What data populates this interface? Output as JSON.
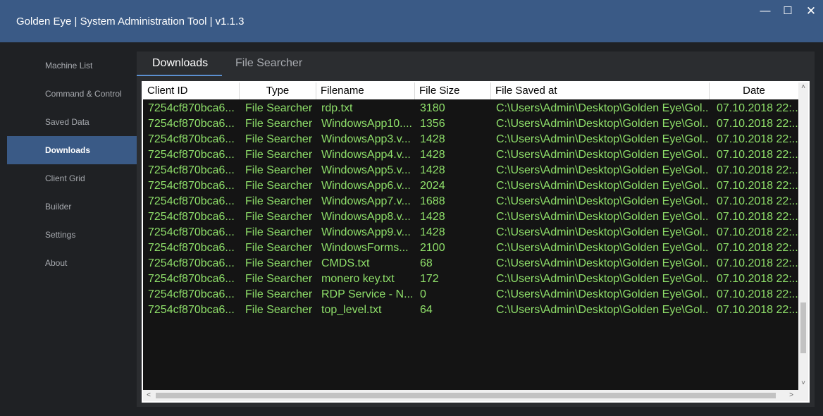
{
  "window": {
    "title": "Golden Eye | System Administration Tool | v1.1.3",
    "minimize_glyph": "—",
    "maximize_glyph": "☐",
    "close_glyph": "✕"
  },
  "sidebar": {
    "items": [
      {
        "label": "Machine List"
      },
      {
        "label": "Command & Control"
      },
      {
        "label": "Saved Data"
      },
      {
        "label": "Downloads",
        "active": true
      },
      {
        "label": "Client Grid"
      },
      {
        "label": "Builder"
      },
      {
        "label": "Settings"
      },
      {
        "label": "About"
      }
    ]
  },
  "tabs": [
    {
      "label": "Downloads",
      "active": true
    },
    {
      "label": "File Searcher"
    }
  ],
  "table": {
    "columns": [
      "Client ID",
      "Type",
      "Filename",
      "File Size",
      "File Saved at",
      "Date"
    ],
    "rows": [
      [
        "7254cf870bca6...",
        "File Searcher",
        "rdp.txt",
        "3180",
        "C:\\Users\\Admin\\Desktop\\Golden Eye\\Gol...",
        "07.10.2018 22:..."
      ],
      [
        "7254cf870bca6...",
        "File Searcher",
        "WindowsApp10....",
        "1356",
        "C:\\Users\\Admin\\Desktop\\Golden Eye\\Gol...",
        "07.10.2018 22:..."
      ],
      [
        "7254cf870bca6...",
        "File Searcher",
        "WindowsApp3.v...",
        "1428",
        "C:\\Users\\Admin\\Desktop\\Golden Eye\\Gol...",
        "07.10.2018 22:..."
      ],
      [
        "7254cf870bca6...",
        "File Searcher",
        "WindowsApp4.v...",
        "1428",
        "C:\\Users\\Admin\\Desktop\\Golden Eye\\Gol...",
        "07.10.2018 22:..."
      ],
      [
        "7254cf870bca6...",
        "File Searcher",
        "WindowsApp5.v...",
        "1428",
        "C:\\Users\\Admin\\Desktop\\Golden Eye\\Gol...",
        "07.10.2018 22:..."
      ],
      [
        "7254cf870bca6...",
        "File Searcher",
        "WindowsApp6.v...",
        "2024",
        "C:\\Users\\Admin\\Desktop\\Golden Eye\\Gol...",
        "07.10.2018 22:..."
      ],
      [
        "7254cf870bca6...",
        "File Searcher",
        "WindowsApp7.v...",
        "1688",
        "C:\\Users\\Admin\\Desktop\\Golden Eye\\Gol...",
        "07.10.2018 22:..."
      ],
      [
        "7254cf870bca6...",
        "File Searcher",
        "WindowsApp8.v...",
        "1428",
        "C:\\Users\\Admin\\Desktop\\Golden Eye\\Gol...",
        "07.10.2018 22:..."
      ],
      [
        "7254cf870bca6...",
        "File Searcher",
        "WindowsApp9.v...",
        "1428",
        "C:\\Users\\Admin\\Desktop\\Golden Eye\\Gol...",
        "07.10.2018 22:..."
      ],
      [
        "7254cf870bca6...",
        "File Searcher",
        "WindowsForms...",
        "2100",
        "C:\\Users\\Admin\\Desktop\\Golden Eye\\Gol...",
        "07.10.2018 22:..."
      ],
      [
        "7254cf870bca6...",
        "File Searcher",
        "CMDS.txt",
        "68",
        "C:\\Users\\Admin\\Desktop\\Golden Eye\\Gol...",
        "07.10.2018 22:..."
      ],
      [
        "7254cf870bca6...",
        "File Searcher",
        "monero key.txt",
        "172",
        "C:\\Users\\Admin\\Desktop\\Golden Eye\\Gol...",
        "07.10.2018 22:..."
      ],
      [
        "7254cf870bca6...",
        "File Searcher",
        "RDP Service - N...",
        "0",
        "C:\\Users\\Admin\\Desktop\\Golden Eye\\Gol...",
        "07.10.2018 22:..."
      ],
      [
        "7254cf870bca6...",
        "File Searcher",
        "top_level.txt",
        "64",
        "C:\\Users\\Admin\\Desktop\\Golden Eye\\Gol...",
        "07.10.2018 22:..."
      ]
    ]
  },
  "scrollbars": {
    "up_glyph": "˄",
    "down_glyph": "˅",
    "left_glyph": "<",
    "right_glyph": ">"
  },
  "colors": {
    "titlebar": "#3a5a86",
    "active_item": "#3a5a86",
    "row_text": "#8fe06a"
  }
}
